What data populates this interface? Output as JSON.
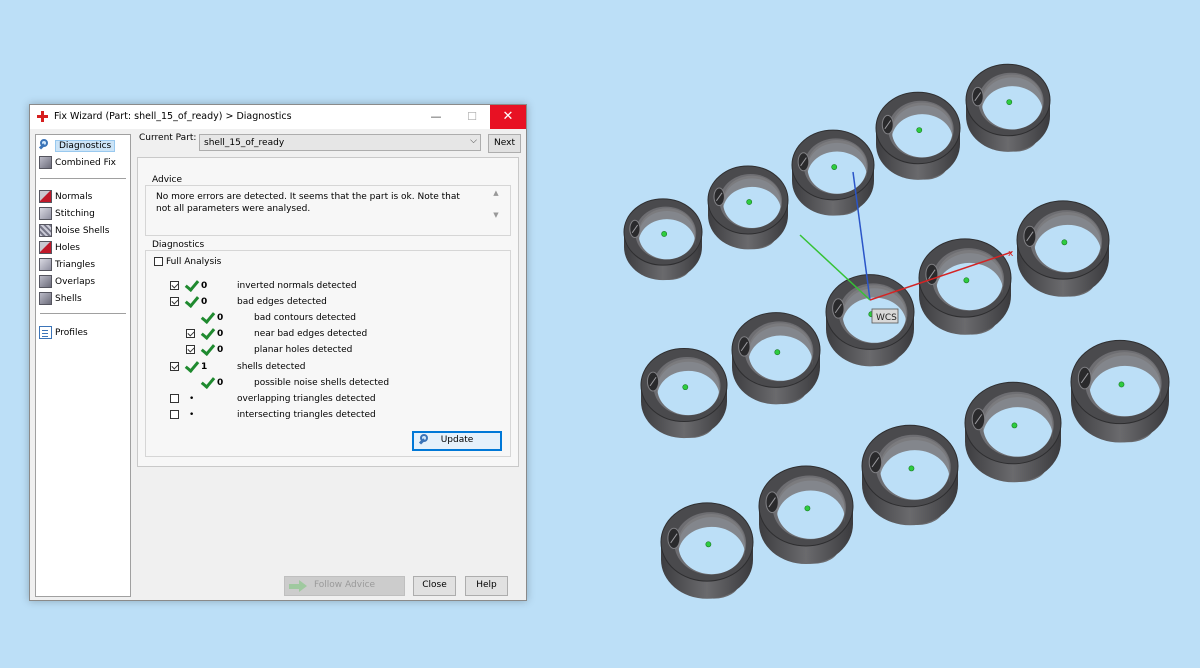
{
  "window": {
    "title": "Fix Wizard (Part: shell_15_of_ready) > Diagnostics",
    "min_glyph": "—",
    "max_glyph": "☐",
    "close_glyph": "✕"
  },
  "nav": {
    "items": [
      {
        "label": "Diagnostics",
        "icon": "magnifier-icon"
      },
      {
        "label": "Combined Fix",
        "icon": "cube-icon"
      },
      {
        "label": "Normals",
        "icon": "normals-cube-icon"
      },
      {
        "label": "Stitching",
        "icon": "stitching-icon"
      },
      {
        "label": "Noise Shells",
        "icon": "noise-shells-icon"
      },
      {
        "label": "Holes",
        "icon": "holes-icon"
      },
      {
        "label": "Triangles",
        "icon": "triangles-icon"
      },
      {
        "label": "Overlaps",
        "icon": "overlaps-icon"
      },
      {
        "label": "Shells",
        "icon": "shells-icon"
      },
      {
        "label": "Profiles",
        "icon": "profiles-icon"
      }
    ]
  },
  "current_part": {
    "label": "Current Part:",
    "value": "shell_15_of_ready",
    "next_label": "Next"
  },
  "advice": {
    "title": "Advice",
    "text": "No more errors are detected. It seems that the part is ok. Note that not all parameters were analysed."
  },
  "diagnostics": {
    "title": "Diagnostics",
    "full_analysis_label": "Full Analysis",
    "rows": [
      {
        "checked": true,
        "ok": true,
        "value": "0",
        "label": "inverted normals detected",
        "indent": 0
      },
      {
        "checked": true,
        "ok": true,
        "value": "0",
        "label": "bad edges detected",
        "indent": 0
      },
      {
        "checked": null,
        "ok": true,
        "value": "0",
        "label": "bad contours detected",
        "indent": 1
      },
      {
        "checked": true,
        "ok": true,
        "value": "0",
        "label": "near bad edges detected",
        "indent": 1
      },
      {
        "checked": true,
        "ok": true,
        "value": "0",
        "label": "planar holes detected",
        "indent": 1
      },
      {
        "checked": true,
        "ok": true,
        "value": "1",
        "label": "shells detected",
        "indent": 0
      },
      {
        "checked": null,
        "ok": true,
        "value": "0",
        "label": "possible noise shells detected",
        "indent": 1
      },
      {
        "checked": false,
        "ok": false,
        "value": "•",
        "label": "overlapping triangles detected",
        "indent": 0
      },
      {
        "checked": false,
        "ok": false,
        "value": "•",
        "label": "intersecting triangles detected",
        "indent": 0
      }
    ],
    "update_label": "Update"
  },
  "footer": {
    "follow_advice_label": "Follow Advice",
    "close_label": "Close",
    "help_label": "Help"
  },
  "viewport": {
    "wcs_label": "WCS",
    "background": "#bcdff7",
    "ring_color": "#5b5b5e",
    "center_dot_color": "#2ecc40"
  }
}
